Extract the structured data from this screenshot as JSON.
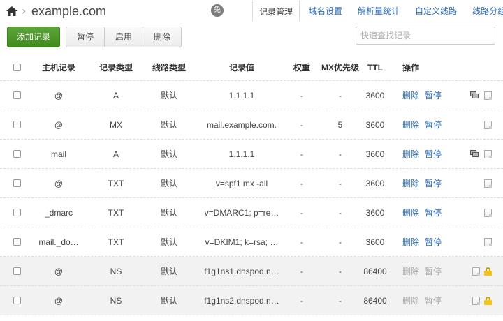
{
  "breadcrumb": {
    "domain": "example.com",
    "badge": "免"
  },
  "tabs": [
    {
      "label": "记录管理",
      "active": true
    },
    {
      "label": "域名设置",
      "active": false
    },
    {
      "label": "解析量统计",
      "active": false
    },
    {
      "label": "自定义线路",
      "active": false
    },
    {
      "label": "线路分组",
      "active": false
    }
  ],
  "toolbar": {
    "add_label": "添加记录",
    "pause_label": "暂停",
    "enable_label": "启用",
    "delete_label": "删除",
    "search_placeholder": "快速查找记录"
  },
  "table": {
    "headers": {
      "host": "主机记录",
      "type": "记录类型",
      "line": "线路类型",
      "value": "记录值",
      "weight": "权重",
      "mx": "MX优先级",
      "ttl": "TTL",
      "ops": "操作"
    },
    "rows": [
      {
        "host": "@",
        "type": "A",
        "line": "默认",
        "value": "1.1.1.1",
        "weight": "-",
        "mx": "-",
        "ttl": "3600",
        "del": "删除",
        "pause": "暂停",
        "lb": true,
        "system": false
      },
      {
        "host": "@",
        "type": "MX",
        "line": "默认",
        "value": "mail.example.com.",
        "weight": "-",
        "mx": "5",
        "ttl": "3600",
        "del": "删除",
        "pause": "暂停",
        "lb": false,
        "system": false
      },
      {
        "host": "mail",
        "type": "A",
        "line": "默认",
        "value": "1.1.1.1",
        "weight": "-",
        "mx": "-",
        "ttl": "3600",
        "del": "删除",
        "pause": "暂停",
        "lb": true,
        "system": false
      },
      {
        "host": "@",
        "type": "TXT",
        "line": "默认",
        "value": "v=spf1 mx -all",
        "weight": "-",
        "mx": "-",
        "ttl": "3600",
        "del": "删除",
        "pause": "暂停",
        "lb": false,
        "system": false
      },
      {
        "host": "_dmarc",
        "type": "TXT",
        "line": "默认",
        "value": "v=DMARC1; p=re…",
        "weight": "-",
        "mx": "-",
        "ttl": "3600",
        "del": "删除",
        "pause": "暂停",
        "lb": false,
        "system": false
      },
      {
        "host": "mail._do…",
        "type": "TXT",
        "line": "默认",
        "value": "v=DKIM1; k=rsa; …",
        "weight": "-",
        "mx": "-",
        "ttl": "3600",
        "del": "删除",
        "pause": "暂停",
        "lb": false,
        "system": false
      },
      {
        "host": "@",
        "type": "NS",
        "line": "默认",
        "value": "f1g1ns1.dnspod.n…",
        "weight": "-",
        "mx": "-",
        "ttl": "86400",
        "del": "删除",
        "pause": "暂停",
        "lb": false,
        "system": true
      },
      {
        "host": "@",
        "type": "NS",
        "line": "默认",
        "value": "f1g1ns2.dnspod.n…",
        "weight": "-",
        "mx": "-",
        "ttl": "86400",
        "del": "删除",
        "pause": "暂停",
        "lb": false,
        "system": true
      }
    ]
  },
  "colors": {
    "accent": "#2b6bb8",
    "add_button": "#4a9a28",
    "system_row": "#f2f2f2",
    "lock": "#f0c419"
  },
  "icons": {
    "home": "home-icon",
    "separator": "chevron-right-icon",
    "load_balance": "load-balance-icon",
    "note": "note-icon",
    "lock": "lock-icon"
  }
}
